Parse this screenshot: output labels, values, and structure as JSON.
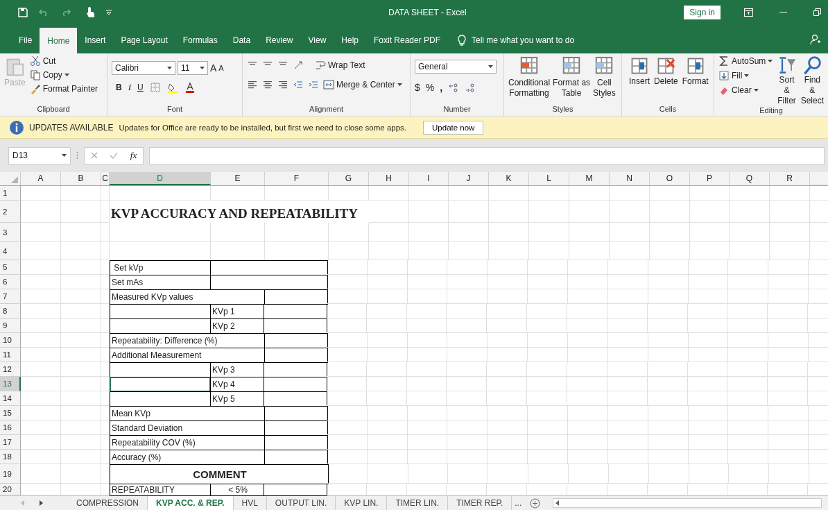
{
  "window": {
    "title": "DATA SHEET  -  Excel",
    "sign_in": "Sign in"
  },
  "menu_tabs": [
    {
      "label": "File",
      "selected": false
    },
    {
      "label": "Home",
      "selected": true
    },
    {
      "label": "Insert",
      "selected": false
    },
    {
      "label": "Page Layout",
      "selected": false
    },
    {
      "label": "Formulas",
      "selected": false
    },
    {
      "label": "Data",
      "selected": false
    },
    {
      "label": "Review",
      "selected": false
    },
    {
      "label": "View",
      "selected": false
    },
    {
      "label": "Help",
      "selected": false
    },
    {
      "label": "Foxit Reader PDF",
      "selected": false
    }
  ],
  "tell_me": "Tell me what you want to do",
  "ribbon": {
    "clipboard": {
      "paste": "Paste",
      "cut": "Cut",
      "copy": "Copy",
      "format_painter": "Format Painter",
      "label": "Clipboard"
    },
    "font": {
      "family": "Calibri",
      "size": "11",
      "grow": "A",
      "shrink": "A",
      "bold": "B",
      "italic": "I",
      "underline": "U",
      "label": "Font"
    },
    "alignment": {
      "wrap": "Wrap Text",
      "merge": "Merge & Center",
      "label": "Alignment"
    },
    "number": {
      "format": "General",
      "currency": "$",
      "percent": "%",
      "comma": ",",
      "label": "Number"
    },
    "styles": {
      "buttons": [
        [
          "Conditional",
          "Formatting"
        ],
        [
          "Format as",
          "Table"
        ],
        [
          "Cell",
          "Styles"
        ]
      ],
      "label": "Styles"
    },
    "cells": {
      "buttons": [
        "Insert",
        "Delete",
        "Format"
      ],
      "label": "Cells"
    },
    "editing": {
      "autosum": "AutoSum",
      "fill": "Fill",
      "clear": "Clear",
      "sort": [
        "Sort &",
        "Filter"
      ],
      "find": [
        "Find &",
        "Select"
      ],
      "label": "Editing"
    }
  },
  "update_bar": {
    "title": "UPDATES AVAILABLE",
    "message": "Updates for Office are ready to be installed, but first we need to close some apps.",
    "button": "Update now"
  },
  "formula_bar": {
    "name_box": "D13",
    "function_label": "fx"
  },
  "columns": [
    "A",
    "B",
    "C",
    "D",
    "E",
    "F",
    "G",
    "H",
    "I",
    "J",
    "K",
    "L",
    "M",
    "N",
    "O",
    "P",
    "Q",
    "R"
  ],
  "rows": [
    {
      "number": "1",
      "cells": []
    },
    {
      "number": "2",
      "kind": "title",
      "cells": [
        {
          "text": "KVP ACCURACY AND REPEATABILITY",
          "selected": false
        }
      ]
    },
    {
      "number": "3",
      "cells": []
    },
    {
      "number": "4",
      "cells": []
    },
    {
      "number": "5",
      "kind": "pair",
      "cells": [
        {
          "text": " Set kVp",
          "selected": false
        },
        {
          "selected": false
        }
      ]
    },
    {
      "number": "6",
      "kind": "pair",
      "cells": [
        {
          "text": "Set mAs",
          "selected": false
        },
        {
          "selected": false
        }
      ]
    },
    {
      "number": "7",
      "kind": "wide",
      "cells": [
        {
          "text": "Measured KVp values",
          "selected": false
        },
        {
          "selected": false
        }
      ]
    },
    {
      "number": "8",
      "kind": "triple",
      "cells": [
        {
          "selected": false
        },
        {
          "text": "KVp 1",
          "selected": false
        },
        {
          "selected": false
        }
      ]
    },
    {
      "number": "9",
      "kind": "triple",
      "cells": [
        {
          "selected": false
        },
        {
          "text": "KVp 2",
          "selected": false
        },
        {
          "selected": false
        }
      ]
    },
    {
      "number": "10",
      "kind": "wide",
      "cells": [
        {
          "text": "Repeatability: Difference (%)",
          "selected": false
        },
        {
          "selected": false
        }
      ]
    },
    {
      "number": "11",
      "kind": "wide",
      "cells": [
        {
          "text": "Additional Measurement",
          "selected": false
        },
        {
          "selected": false
        }
      ]
    },
    {
      "number": "12",
      "kind": "triple",
      "cells": [
        {
          "selected": false
        },
        {
          "text": "KVp 3",
          "selected": false
        },
        {
          "selected": false
        }
      ]
    },
    {
      "number": "13",
      "kind": "triple",
      "cells": [
        {
          "selected": true
        },
        {
          "text": "KVp 4",
          "selected": false
        },
        {
          "selected": false
        }
      ]
    },
    {
      "number": "14",
      "kind": "triple",
      "cells": [
        {
          "selected": false
        },
        {
          "text": "KVp 5",
          "selected": false
        },
        {
          "selected": false
        }
      ]
    },
    {
      "number": "15",
      "kind": "wide",
      "cells": [
        {
          "text": "Mean KVp",
          "selected": false
        },
        {
          "selected": false
        }
      ]
    },
    {
      "number": "16",
      "kind": "wide",
      "cells": [
        {
          "text": "Standard Deviation",
          "selected": false
        },
        {
          "selected": false
        }
      ]
    },
    {
      "number": "17",
      "kind": "wide",
      "cells": [
        {
          "text": "Repeatability COV (%)",
          "selected": false
        },
        {
          "selected": false
        }
      ]
    },
    {
      "number": "18",
      "kind": "wide",
      "cells": [
        {
          "text": "Accuracy (%)",
          "selected": false
        },
        {
          "selected": false
        }
      ]
    },
    {
      "number": "19",
      "kind": "full",
      "cells": [
        {
          "text": "COMMENT",
          "selected": false
        }
      ]
    },
    {
      "number": "20",
      "kind": "triple",
      "cells": [
        {
          "text": "REPEATABILITY",
          "selected": false
        },
        {
          "text": "< 5%",
          "kind": "center",
          "selected": false
        },
        {
          "selected": false
        }
      ]
    }
  ],
  "sheet_tabs": [
    {
      "label": "COMPRESSION",
      "selected": false
    },
    {
      "label": "KVP ACC. & REP.",
      "selected": true
    },
    {
      "label": "HVL",
      "selected": false
    },
    {
      "label": "OUTPUT LIN.",
      "selected": false
    },
    {
      "label": "KVP LIN.",
      "selected": false
    },
    {
      "label": "TIMER LIN.",
      "selected": false
    },
    {
      "label": "TIMER REP.",
      "selected": false
    }
  ],
  "more_tabs": "..."
}
